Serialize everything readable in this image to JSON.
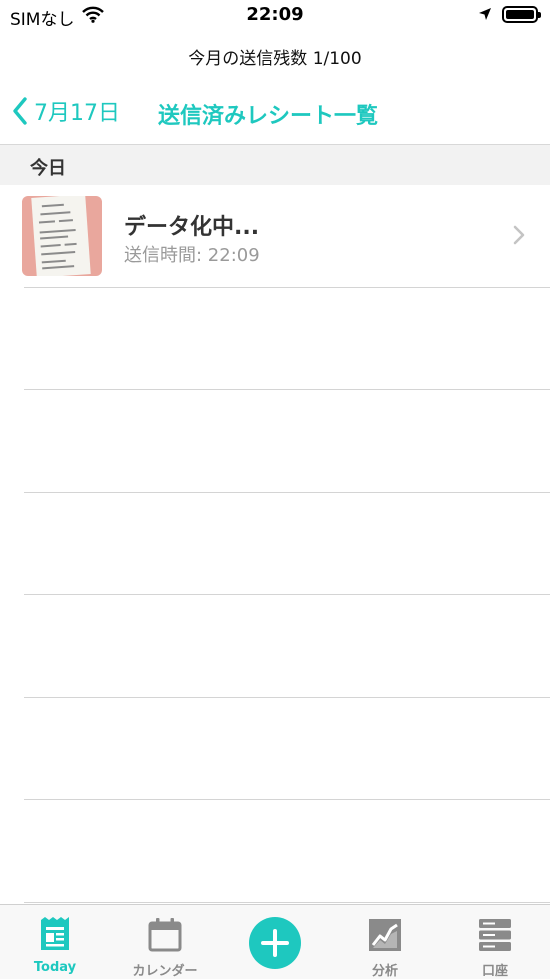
{
  "status_bar": {
    "carrier": "SIMなし",
    "time": "22:09"
  },
  "quota_text": "今月の送信残数 1/100",
  "nav": {
    "back_label": "7月17日",
    "title": "送信済みレシート一覧"
  },
  "section": {
    "header": "今日"
  },
  "receipts": [
    {
      "title": "データ化中...",
      "subtitle": "送信時間: 22:09"
    }
  ],
  "tabbar": {
    "today": "Today",
    "calendar": "カレンダー",
    "analysis": "分析",
    "account": "口座"
  },
  "colors": {
    "accent": "#1ec8bf",
    "inactive": "#8a8a8a"
  },
  "icons": {
    "status": [
      "wifi-icon",
      "location-arrow-icon",
      "battery-icon"
    ],
    "nav": "chevron-left-icon",
    "row": "chevron-right-icon",
    "tabs": [
      "receipt-icon",
      "calendar-icon",
      "plus-icon",
      "chart-icon",
      "server-icon"
    ]
  }
}
